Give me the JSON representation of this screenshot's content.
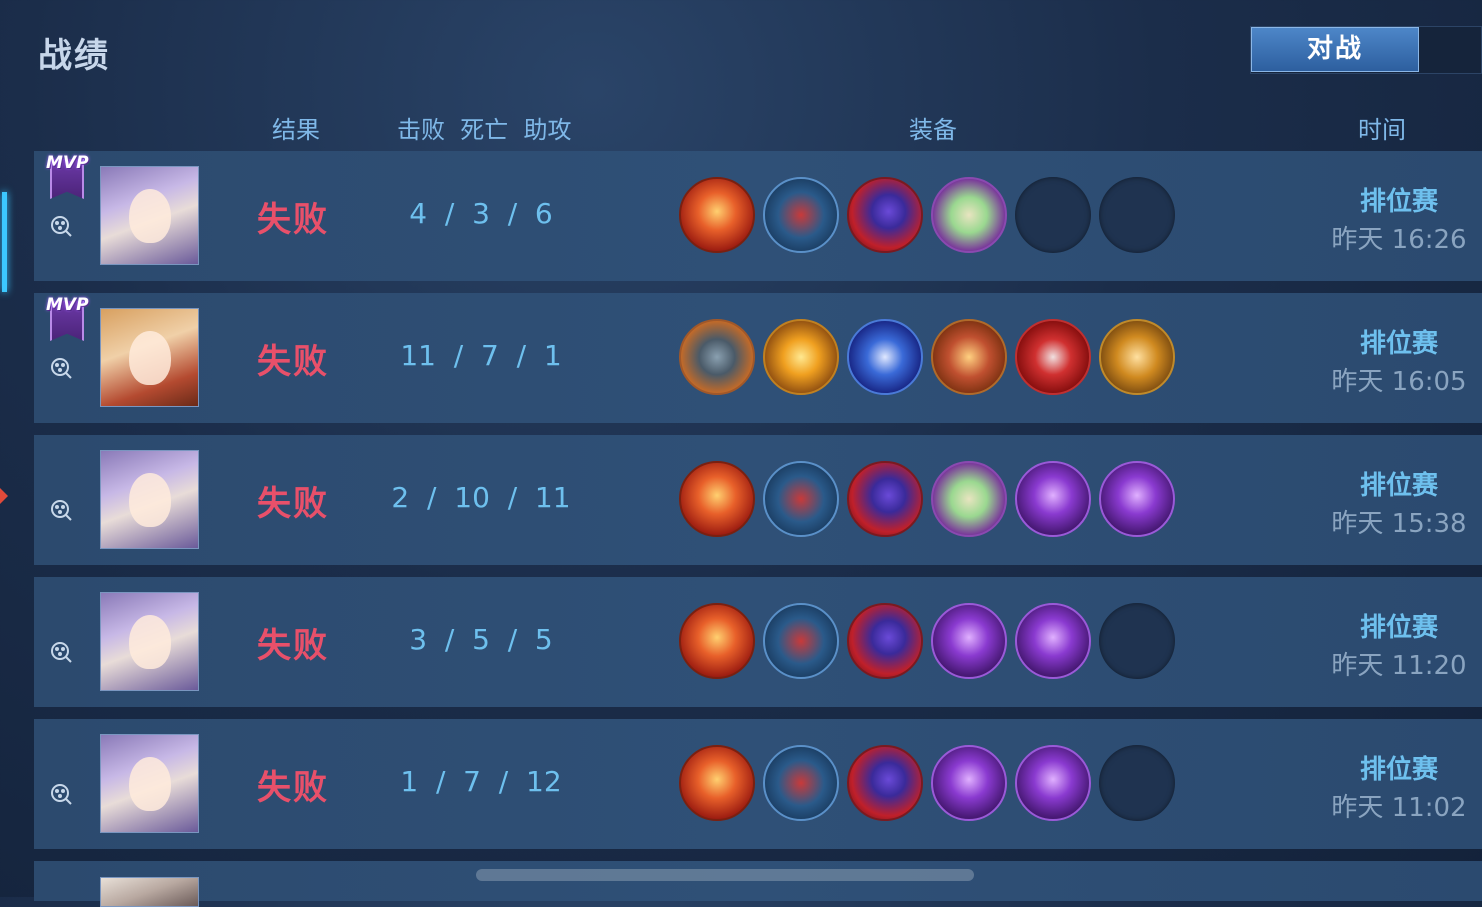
{
  "header": {
    "title": "战绩",
    "tab_active": "对战"
  },
  "columns": {
    "result": "结果",
    "kda": "击败  死亡  助攻",
    "equipment": "装备",
    "time": "时间"
  },
  "colors": {
    "loss_text": "#e8506a",
    "accent_blue": "#6ec0ee",
    "mvp_purple": "#6c3aa8"
  },
  "matches": [
    {
      "mvp": true,
      "mvp_label": "MVP",
      "avatar": "hero-silver-hair",
      "result": "失败",
      "kda": "4  /  3  /  6",
      "items": [
        "fire-gauntlet-icon",
        "red-boots-icon",
        "purple-hat-icon",
        "magic-book-icon",
        "empty-slot",
        "empty-slot"
      ],
      "mode": "排位赛",
      "time": "昨天 16:26"
    },
    {
      "mvp": true,
      "mvp_label": "MVP",
      "avatar": "hero-masked-girl",
      "result": "失败",
      "kda": "11  /  7  /  1",
      "items": [
        "armor-boots-icon",
        "lightning-blade-icon",
        "trident-icon",
        "claw-blade-icon",
        "war-hammer-icon",
        "golden-scythe-icon"
      ],
      "mode": "排位赛",
      "time": "昨天 16:05"
    },
    {
      "mvp": false,
      "avatar": "hero-silver-hair",
      "result": "失败",
      "kda": "2  /  10  /  11",
      "items": [
        "fire-gauntlet-icon",
        "red-boots-icon",
        "purple-hat-icon",
        "magic-book-icon",
        "arcane-staff-icon",
        "arcane-staff-icon"
      ],
      "mode": "排位赛",
      "time": "昨天 15:38"
    },
    {
      "mvp": false,
      "avatar": "hero-silver-hair",
      "result": "失败",
      "kda": "3  /  5  /  5",
      "items": [
        "fire-gauntlet-icon",
        "red-boots-icon",
        "purple-hat-icon",
        "arcane-staff-icon",
        "arcane-staff-icon",
        "empty-slot"
      ],
      "mode": "排位赛",
      "time": "昨天 11:20"
    },
    {
      "mvp": false,
      "avatar": "hero-silver-hair",
      "result": "失败",
      "kda": "1  /  7  /  12",
      "items": [
        "fire-gauntlet-icon",
        "red-boots-icon",
        "purple-hat-icon",
        "arcane-staff-icon",
        "arcane-staff-icon",
        "empty-slot"
      ],
      "mode": "排位赛",
      "time": "昨天 11:02"
    }
  ]
}
